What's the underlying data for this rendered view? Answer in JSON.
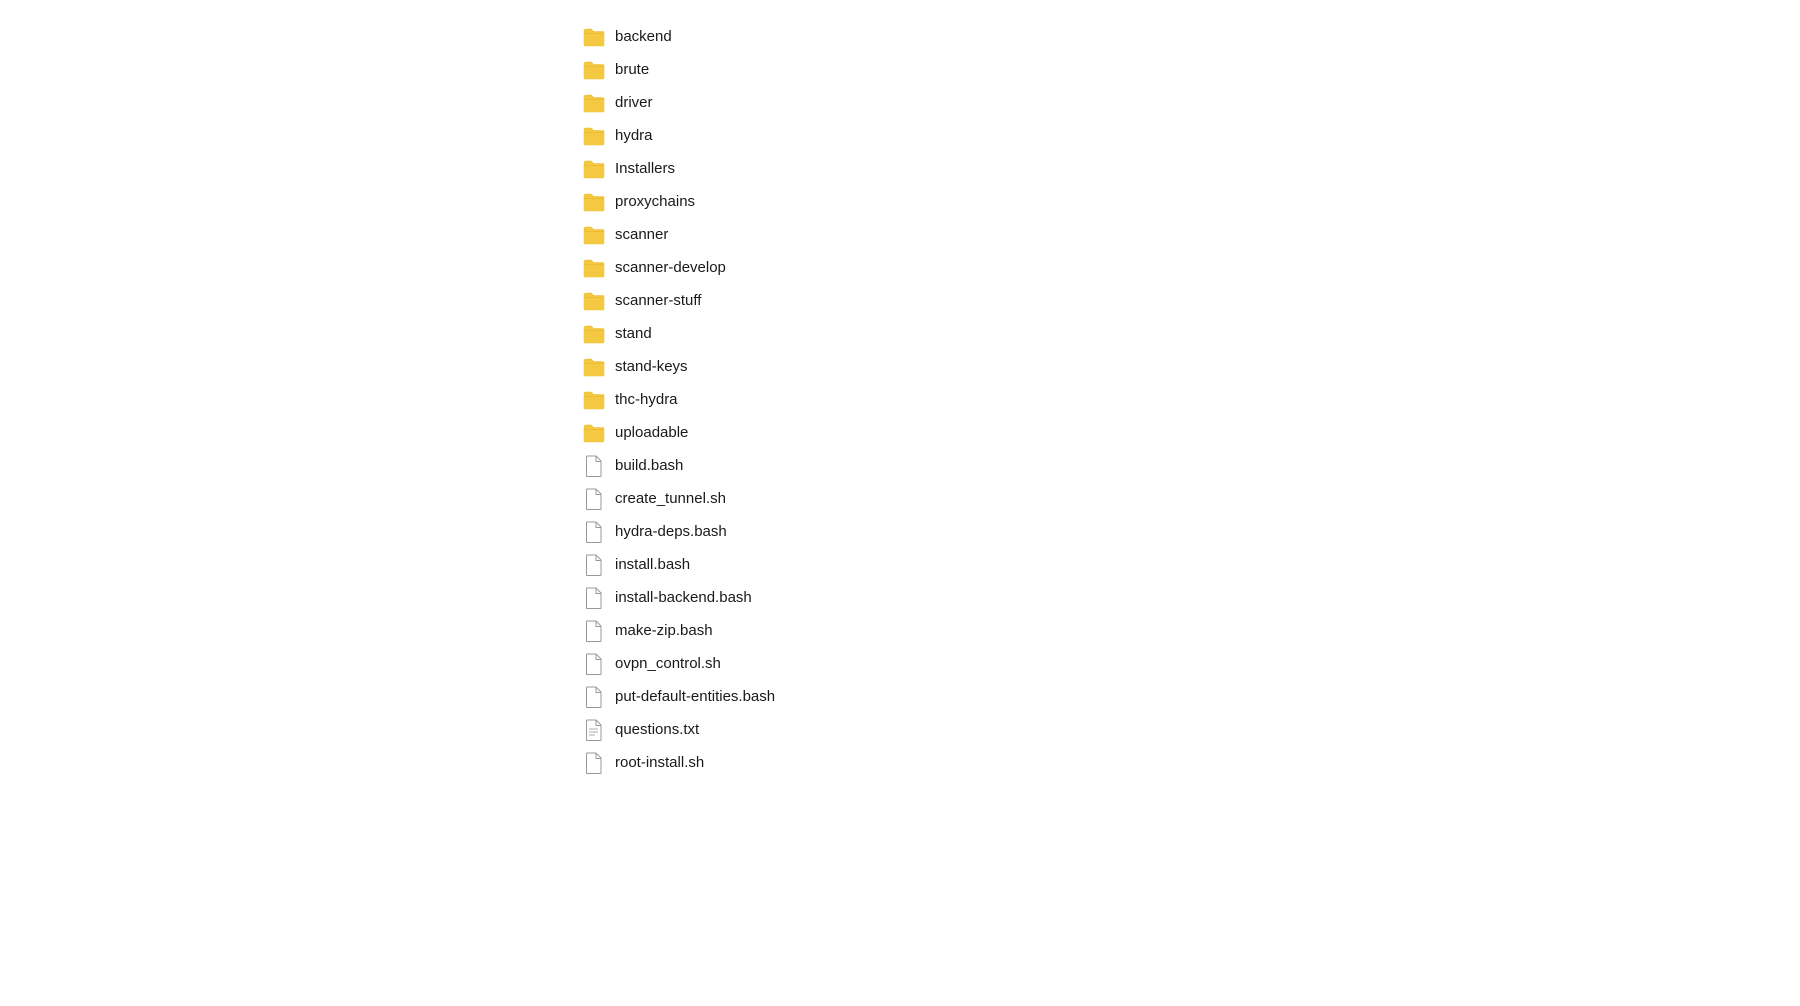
{
  "files": [
    {
      "id": "backend",
      "name": "backend",
      "type": "folder"
    },
    {
      "id": "brute",
      "name": "brute",
      "type": "folder"
    },
    {
      "id": "driver",
      "name": "driver",
      "type": "folder"
    },
    {
      "id": "hydra",
      "name": "hydra",
      "type": "folder"
    },
    {
      "id": "Installers",
      "name": "Installers",
      "type": "folder"
    },
    {
      "id": "proxychains",
      "name": "proxychains",
      "type": "folder"
    },
    {
      "id": "scanner",
      "name": "scanner",
      "type": "folder"
    },
    {
      "id": "scanner-develop",
      "name": "scanner-develop",
      "type": "folder"
    },
    {
      "id": "scanner-stuff",
      "name": "scanner-stuff",
      "type": "folder"
    },
    {
      "id": "stand",
      "name": "stand",
      "type": "folder"
    },
    {
      "id": "stand-keys",
      "name": "stand-keys",
      "type": "folder"
    },
    {
      "id": "thc-hydra",
      "name": "thc-hydra",
      "type": "folder"
    },
    {
      "id": "uploadable",
      "name": "uploadable",
      "type": "folder"
    },
    {
      "id": "build.bash",
      "name": "build.bash",
      "type": "file"
    },
    {
      "id": "create_tunnel.sh",
      "name": "create_tunnel.sh",
      "type": "file"
    },
    {
      "id": "hydra-deps.bash",
      "name": "hydra-deps.bash",
      "type": "file"
    },
    {
      "id": "install.bash",
      "name": "install.bash",
      "type": "file"
    },
    {
      "id": "install-backend.bash",
      "name": "install-backend.bash",
      "type": "file"
    },
    {
      "id": "make-zip.bash",
      "name": "make-zip.bash",
      "type": "file"
    },
    {
      "id": "ovpn_control.sh",
      "name": "ovpn_control.sh",
      "type": "file"
    },
    {
      "id": "put-default-entities.bash",
      "name": "put-default-entities.bash",
      "type": "file"
    },
    {
      "id": "questions.txt",
      "name": "questions.txt",
      "type": "file-lines"
    },
    {
      "id": "root-install.sh",
      "name": "root-install.sh",
      "type": "file"
    }
  ],
  "colors": {
    "folder": "#f5c842",
    "folder_tab": "#e8b830",
    "file_border": "#aaaaaa",
    "text": "#1a1a1a"
  }
}
